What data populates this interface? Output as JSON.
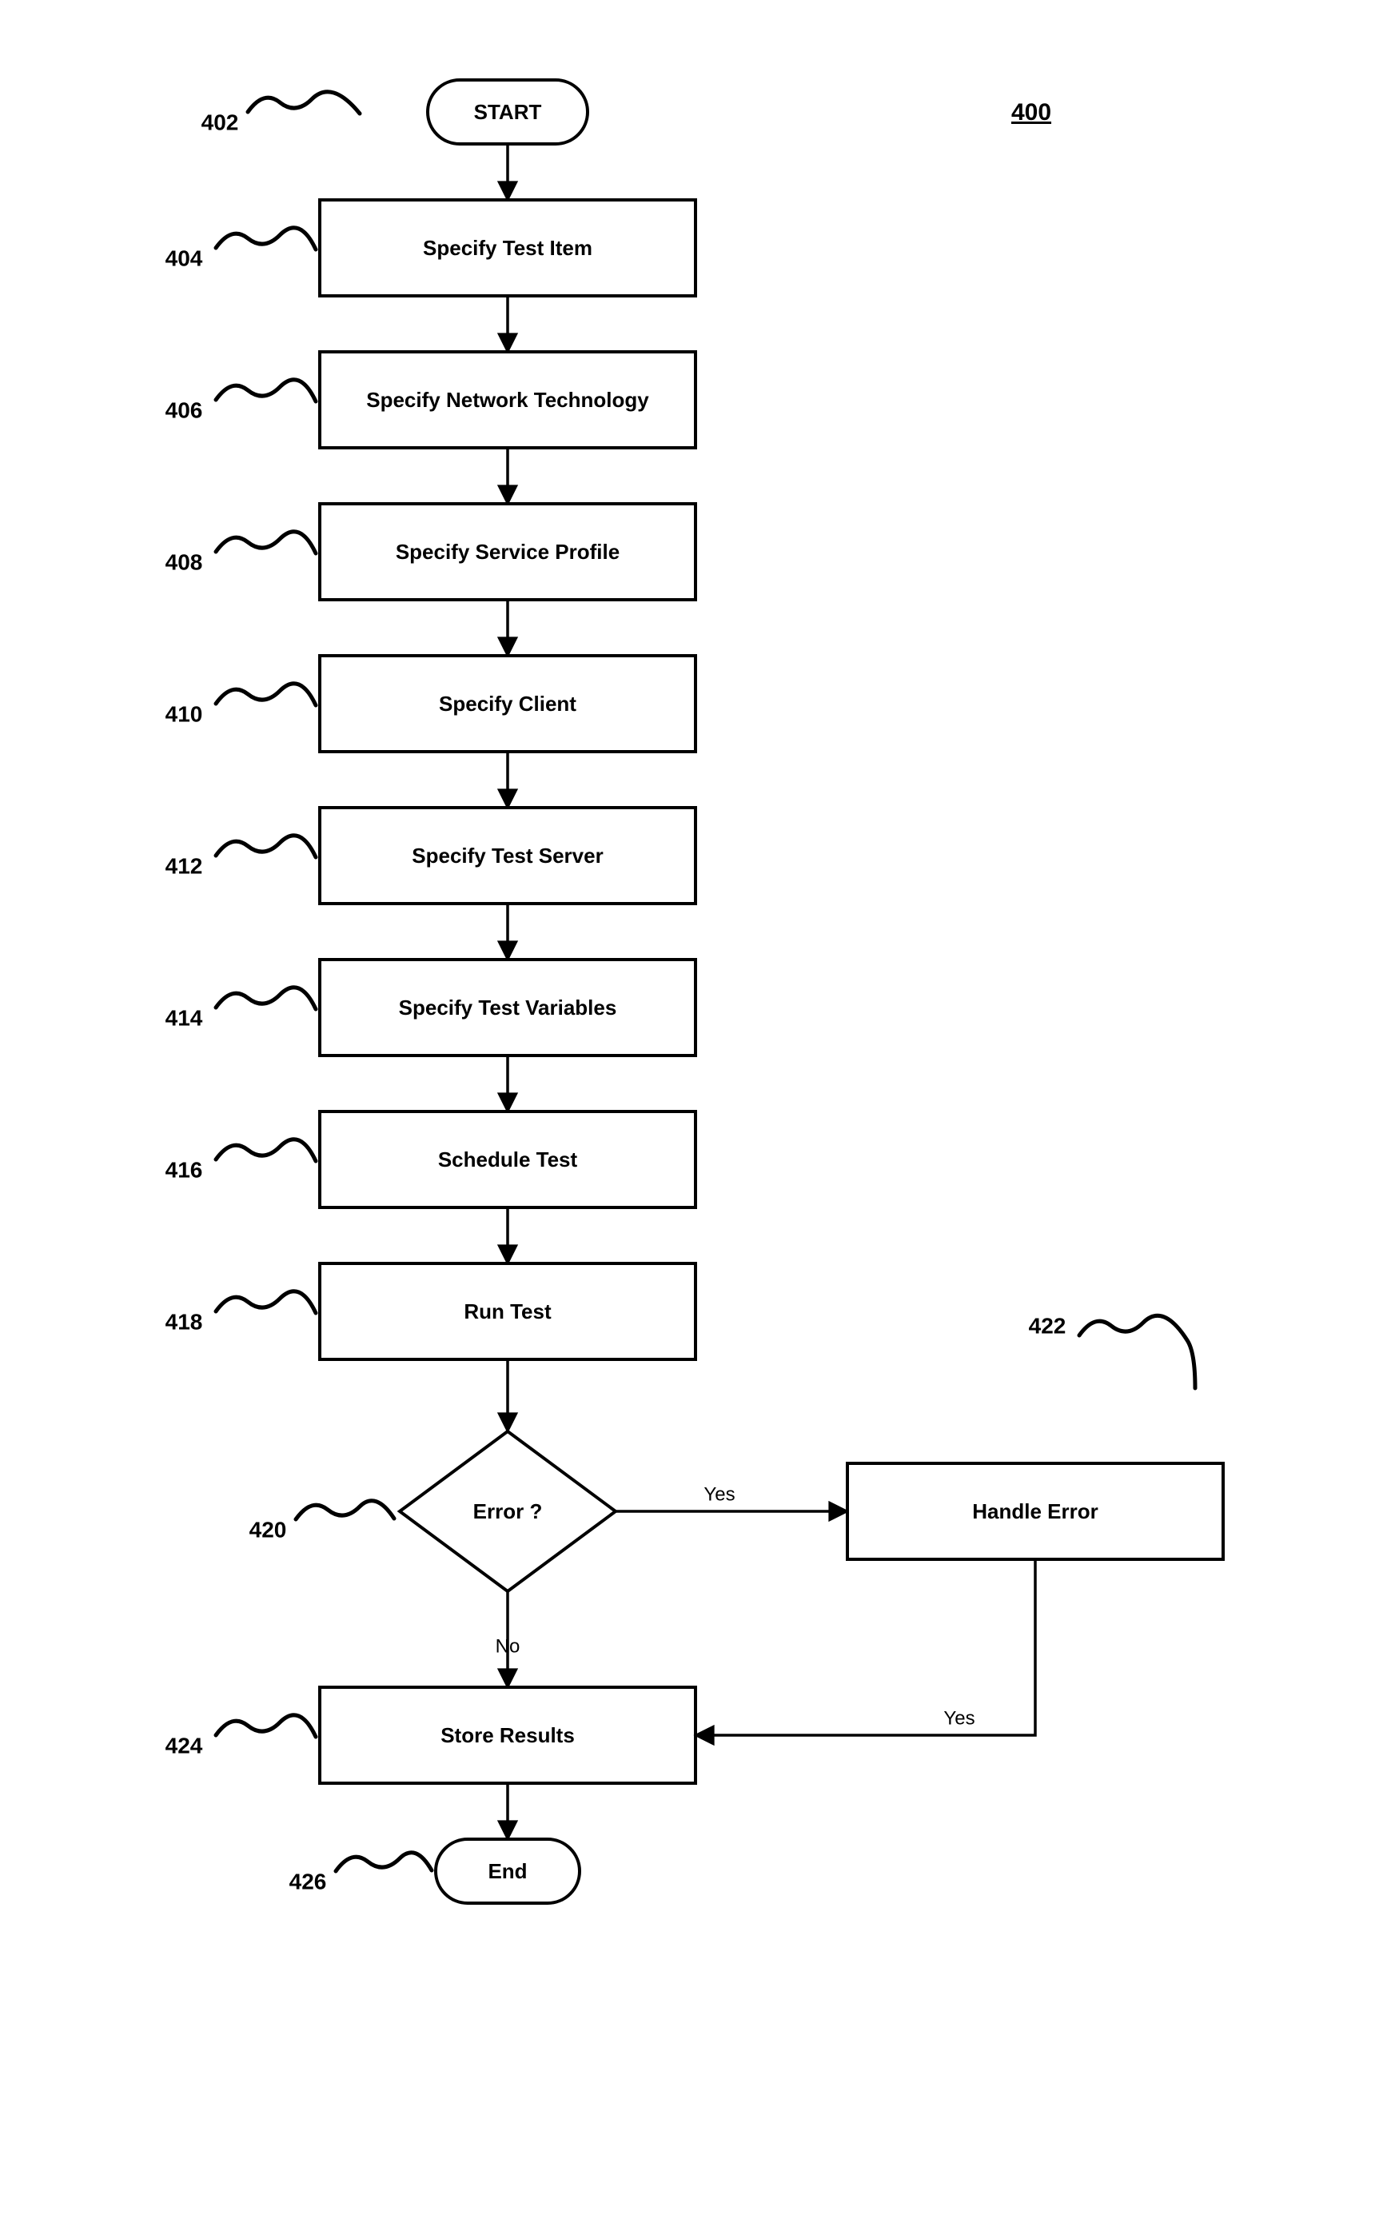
{
  "figure_id": "400",
  "nodes": {
    "start": {
      "ref": "402",
      "label": "START"
    },
    "n404": {
      "ref": "404",
      "label": "Specify Test Item"
    },
    "n406": {
      "ref": "406",
      "label": "Specify Network Technology"
    },
    "n408": {
      "ref": "408",
      "label": "Specify Service Profile"
    },
    "n410": {
      "ref": "410",
      "label": "Specify Client"
    },
    "n412": {
      "ref": "412",
      "label": "Specify Test Server"
    },
    "n414": {
      "ref": "414",
      "label": "Specify Test Variables"
    },
    "n416": {
      "ref": "416",
      "label": "Schedule Test"
    },
    "n418": {
      "ref": "418",
      "label": "Run Test"
    },
    "dec": {
      "ref": "420",
      "label": "Error ?"
    },
    "n422": {
      "ref": "422",
      "label": "Handle Error"
    },
    "n424": {
      "ref": "424",
      "label": "Store Results"
    },
    "end": {
      "ref": "426",
      "label": "End"
    }
  },
  "edges": {
    "yes_to_handle": "Yes",
    "no_to_store": "No",
    "yes_to_store": "Yes"
  },
  "chart_data": {
    "type": "flowchart",
    "nodes": [
      {
        "id": "402",
        "shape": "terminator",
        "label": "START"
      },
      {
        "id": "404",
        "shape": "process",
        "label": "Specify Test Item"
      },
      {
        "id": "406",
        "shape": "process",
        "label": "Specify Network Technology"
      },
      {
        "id": "408",
        "shape": "process",
        "label": "Specify Service Profile"
      },
      {
        "id": "410",
        "shape": "process",
        "label": "Specify Client"
      },
      {
        "id": "412",
        "shape": "process",
        "label": "Specify Test Server"
      },
      {
        "id": "414",
        "shape": "process",
        "label": "Specify Test Variables"
      },
      {
        "id": "416",
        "shape": "process",
        "label": "Schedule Test"
      },
      {
        "id": "418",
        "shape": "process",
        "label": "Run Test"
      },
      {
        "id": "420",
        "shape": "decision",
        "label": "Error ?"
      },
      {
        "id": "422",
        "shape": "process",
        "label": "Handle Error"
      },
      {
        "id": "424",
        "shape": "process",
        "label": "Store Results"
      },
      {
        "id": "426",
        "shape": "terminator",
        "label": "End"
      }
    ],
    "edges": [
      {
        "from": "402",
        "to": "404"
      },
      {
        "from": "404",
        "to": "406"
      },
      {
        "from": "406",
        "to": "408"
      },
      {
        "from": "408",
        "to": "410"
      },
      {
        "from": "410",
        "to": "412"
      },
      {
        "from": "412",
        "to": "414"
      },
      {
        "from": "414",
        "to": "416"
      },
      {
        "from": "416",
        "to": "418"
      },
      {
        "from": "418",
        "to": "420"
      },
      {
        "from": "420",
        "to": "422",
        "label": "Yes"
      },
      {
        "from": "420",
        "to": "424",
        "label": "No"
      },
      {
        "from": "422",
        "to": "424",
        "label": "Yes"
      }
    ],
    "figure_ref": "400"
  }
}
